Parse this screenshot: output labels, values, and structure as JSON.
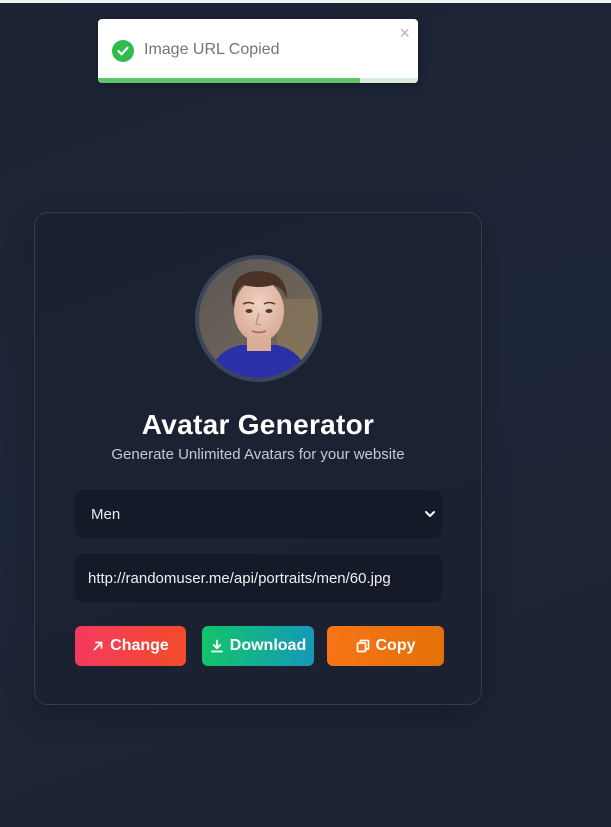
{
  "toast": {
    "message": "Image URL Copied",
    "close_glyph": "×",
    "progress": 0.82,
    "icon": "check-circle-icon",
    "accent": "#2fbc4c"
  },
  "card": {
    "title": "Avatar Generator",
    "subtitle": "Generate Unlimited Avatars for your website",
    "category": {
      "selected": "Men",
      "icon": "chevron-down-icon"
    },
    "image_url": "http://randomuser.me/api/portraits/men/60.jpg",
    "buttons": {
      "change": {
        "label": "Change",
        "icon": "arrow-up-right-icon",
        "color": "#f43a5e"
      },
      "download": {
        "label": "Download",
        "icon": "download-icon",
        "color": "#12c46a"
      },
      "copy": {
        "label": "Copy",
        "icon": "copy-icon",
        "color": "#f97316"
      }
    }
  }
}
